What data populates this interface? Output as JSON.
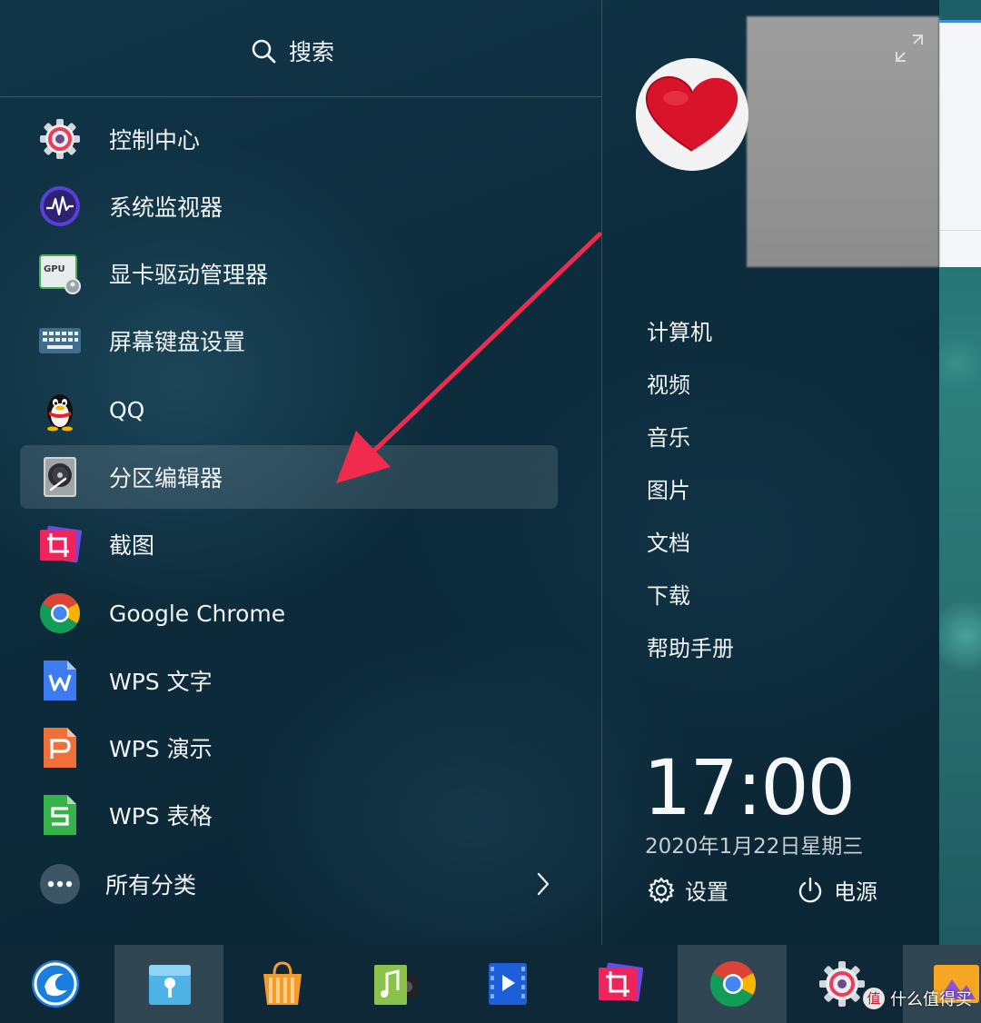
{
  "search": {
    "placeholder": "搜索"
  },
  "apps": [
    {
      "label": "控制中心",
      "icon": "control-center-icon"
    },
    {
      "label": "系统监视器",
      "icon": "system-monitor-icon"
    },
    {
      "label": "显卡驱动管理器",
      "icon": "gpu-driver-icon",
      "icon_text": "GPU"
    },
    {
      "label": "屏幕键盘设置",
      "icon": "keyboard-icon"
    },
    {
      "label": "QQ",
      "icon": "qq-penguin-icon"
    },
    {
      "label": "分区编辑器",
      "icon": "partition-editor-icon",
      "selected": true
    },
    {
      "label": "截图",
      "icon": "screenshot-icon"
    },
    {
      "label": "Google Chrome",
      "icon": "chrome-icon"
    },
    {
      "label": "WPS 文字",
      "icon": "wps-writer-icon"
    },
    {
      "label": "WPS 演示",
      "icon": "wps-presentation-icon"
    },
    {
      "label": "WPS 表格",
      "icon": "wps-spreadsheet-icon"
    }
  ],
  "all_categories": {
    "label": "所有分类"
  },
  "places": [
    "计算机",
    "视频",
    "音乐",
    "图片",
    "文档",
    "下载",
    "帮助手册"
  ],
  "clock": {
    "time": "17:00",
    "date": "2020年1月22日星期三"
  },
  "buttons": {
    "settings": "设置",
    "power": "电源"
  },
  "dock": [
    "launcher-icon",
    "file-manager-icon",
    "app-store-icon",
    "music-icon",
    "movie-icon",
    "screenshot-icon",
    "chrome-icon",
    "control-center-icon",
    "image-viewer-icon"
  ],
  "watermark": {
    "text": "什么值得买",
    "badge": "值"
  },
  "colors": {
    "accent": "#f03b58",
    "wps_blue": "#3d7cf0",
    "wps_orange": "#f0703a",
    "wps_green": "#37b24a"
  }
}
